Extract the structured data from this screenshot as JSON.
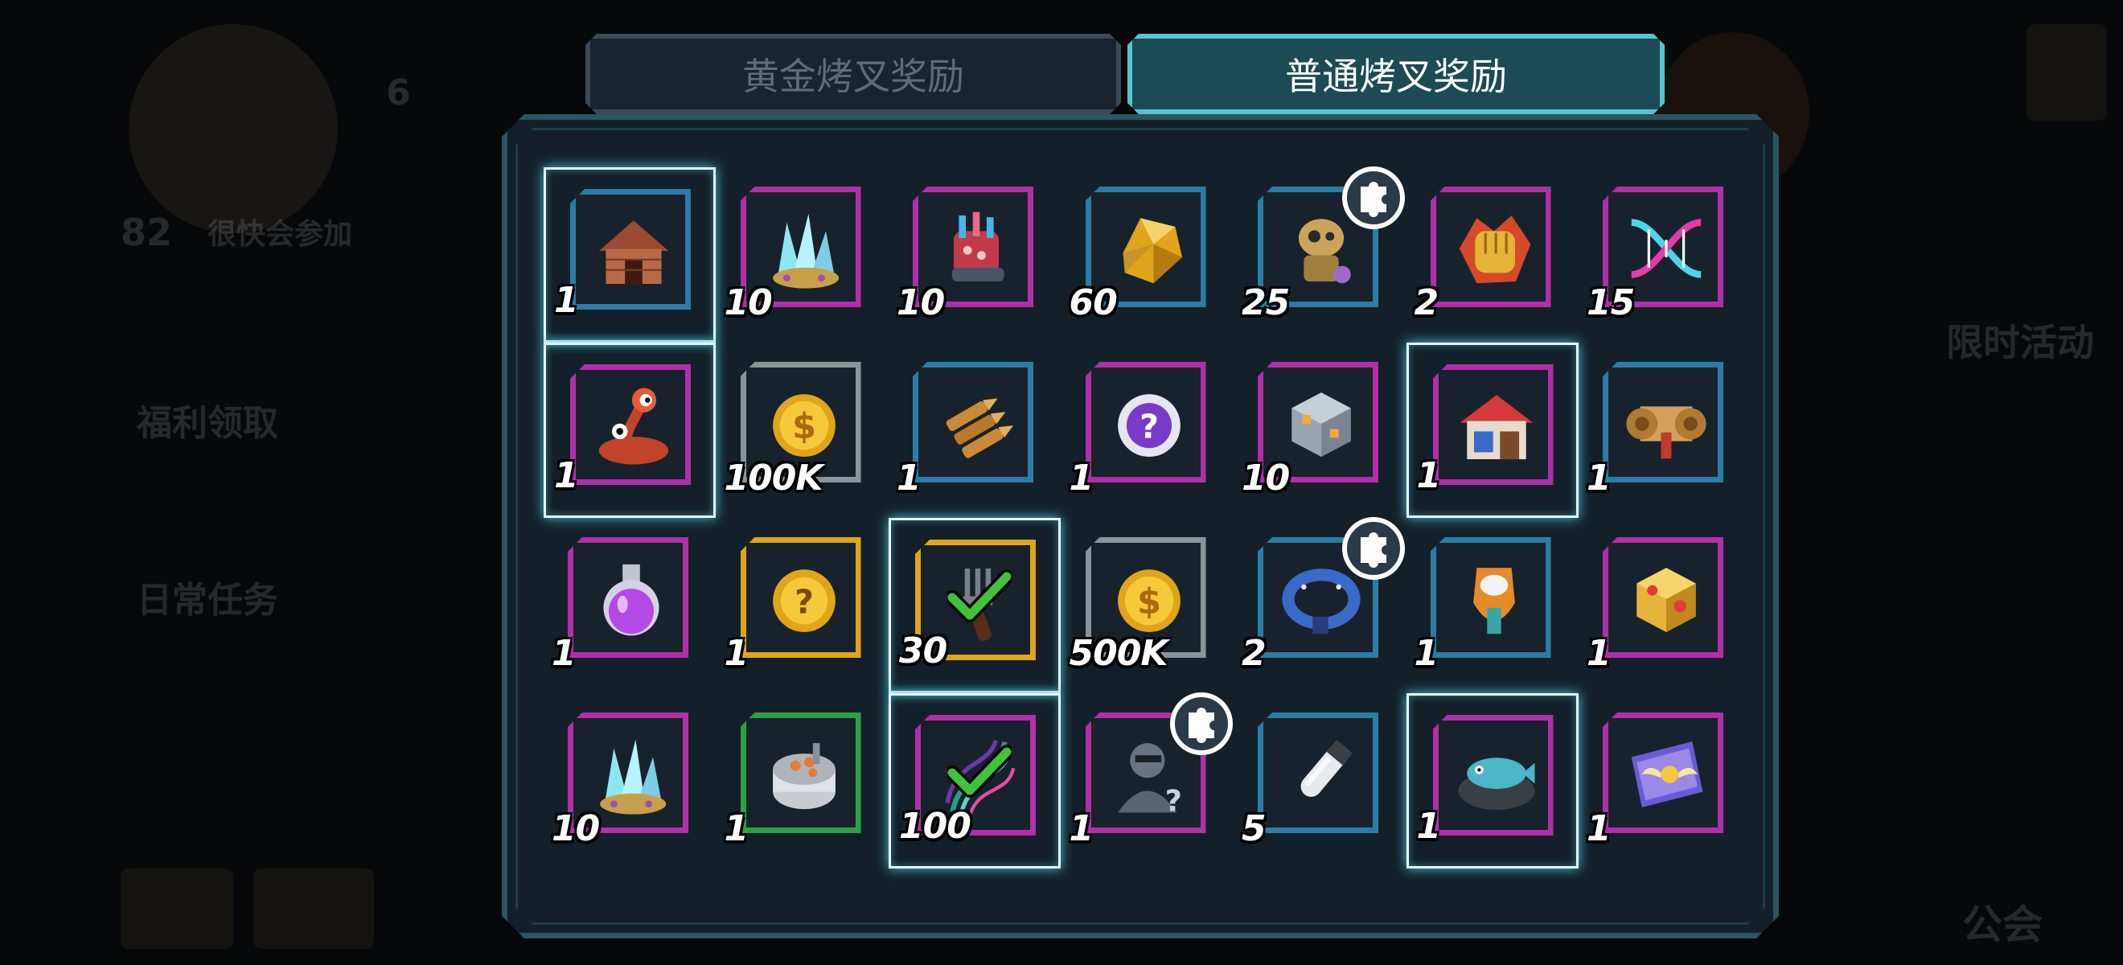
{
  "background": {
    "labels": [
      "很快会参加",
      "福利领取",
      "日常任务",
      "限时活动",
      "公会"
    ],
    "counts": [
      "6",
      "82"
    ]
  },
  "tabs": [
    {
      "label": "黄金烤叉奖励",
      "active": false
    },
    {
      "label": "普通烤叉奖励",
      "active": true
    }
  ],
  "rewards": [
    {
      "qty": "1",
      "icon": "doghouse-icon",
      "rarity": "blue",
      "selected": true
    },
    {
      "qty": "10",
      "icon": "crystal-cluster-icon",
      "rarity": "purple"
    },
    {
      "qty": "10",
      "icon": "coral-gauntlet-icon",
      "rarity": "purple"
    },
    {
      "qty": "60",
      "icon": "amber-crystal-icon",
      "rarity": "blue"
    },
    {
      "qty": "25",
      "icon": "robot-icon",
      "rarity": "blue",
      "fragment": true
    },
    {
      "qty": "2",
      "icon": "golden-fist-icon",
      "rarity": "purple"
    },
    {
      "qty": "15",
      "icon": "dna-helix-icon",
      "rarity": "purple"
    },
    {
      "qty": "1",
      "icon": "alien-creature-icon",
      "rarity": "purple",
      "selected": true
    },
    {
      "qty": "100K",
      "icon": "gold-coin-icon",
      "rarity": "gray"
    },
    {
      "qty": "1",
      "icon": "bullets-icon",
      "rarity": "blue"
    },
    {
      "qty": "1",
      "icon": "mystery-chip-icon",
      "rarity": "purple"
    },
    {
      "qty": "10",
      "icon": "cube-icon",
      "rarity": "purple"
    },
    {
      "qty": "1",
      "icon": "house-icon",
      "rarity": "purple",
      "selected": true
    },
    {
      "qty": "1",
      "icon": "scroll-icon",
      "rarity": "blue"
    },
    {
      "qty": "1",
      "icon": "potion-icon",
      "rarity": "purple"
    },
    {
      "qty": "1",
      "icon": "mystery-coin-icon",
      "rarity": "gold"
    },
    {
      "qty": "30",
      "icon": "fork-icon",
      "rarity": "gold",
      "selected": true,
      "claimed": true
    },
    {
      "qty": "500K",
      "icon": "gold-coin-icon",
      "rarity": "gray"
    },
    {
      "qty": "2",
      "icon": "collar-icon",
      "rarity": "blue",
      "fragment": true
    },
    {
      "qty": "1",
      "icon": "bottle-opener-icon",
      "rarity": "blue"
    },
    {
      "qty": "1",
      "icon": "gold-cube-icon",
      "rarity": "purple"
    },
    {
      "qty": "10",
      "icon": "crystal-cluster-icon",
      "rarity": "purple"
    },
    {
      "qty": "1",
      "icon": "food-can-icon",
      "rarity": "green"
    },
    {
      "qty": "100",
      "icon": "hair-strands-icon",
      "rarity": "purple",
      "selected": true,
      "claimed": true
    },
    {
      "qty": "1",
      "icon": "mystery-character-icon",
      "rarity": "purple",
      "fragment": true
    },
    {
      "qty": "5",
      "icon": "test-tube-icon",
      "rarity": "blue"
    },
    {
      "qty": "1",
      "icon": "fish-bowl-icon",
      "rarity": "purple",
      "selected": true
    },
    {
      "qty": "1",
      "icon": "winged-ticket-icon",
      "rarity": "purple"
    }
  ],
  "colors": {
    "tab_active_border": "#57c3d3",
    "tab_inactive_border": "#3a4a56",
    "rarity_purple": "#b12fa8",
    "rarity_blue": "#2b7da6",
    "rarity_gray": "#8c9499",
    "rarity_gold": "#e0a51c",
    "rarity_green": "#2ea043",
    "check_green": "#3ec43a"
  }
}
